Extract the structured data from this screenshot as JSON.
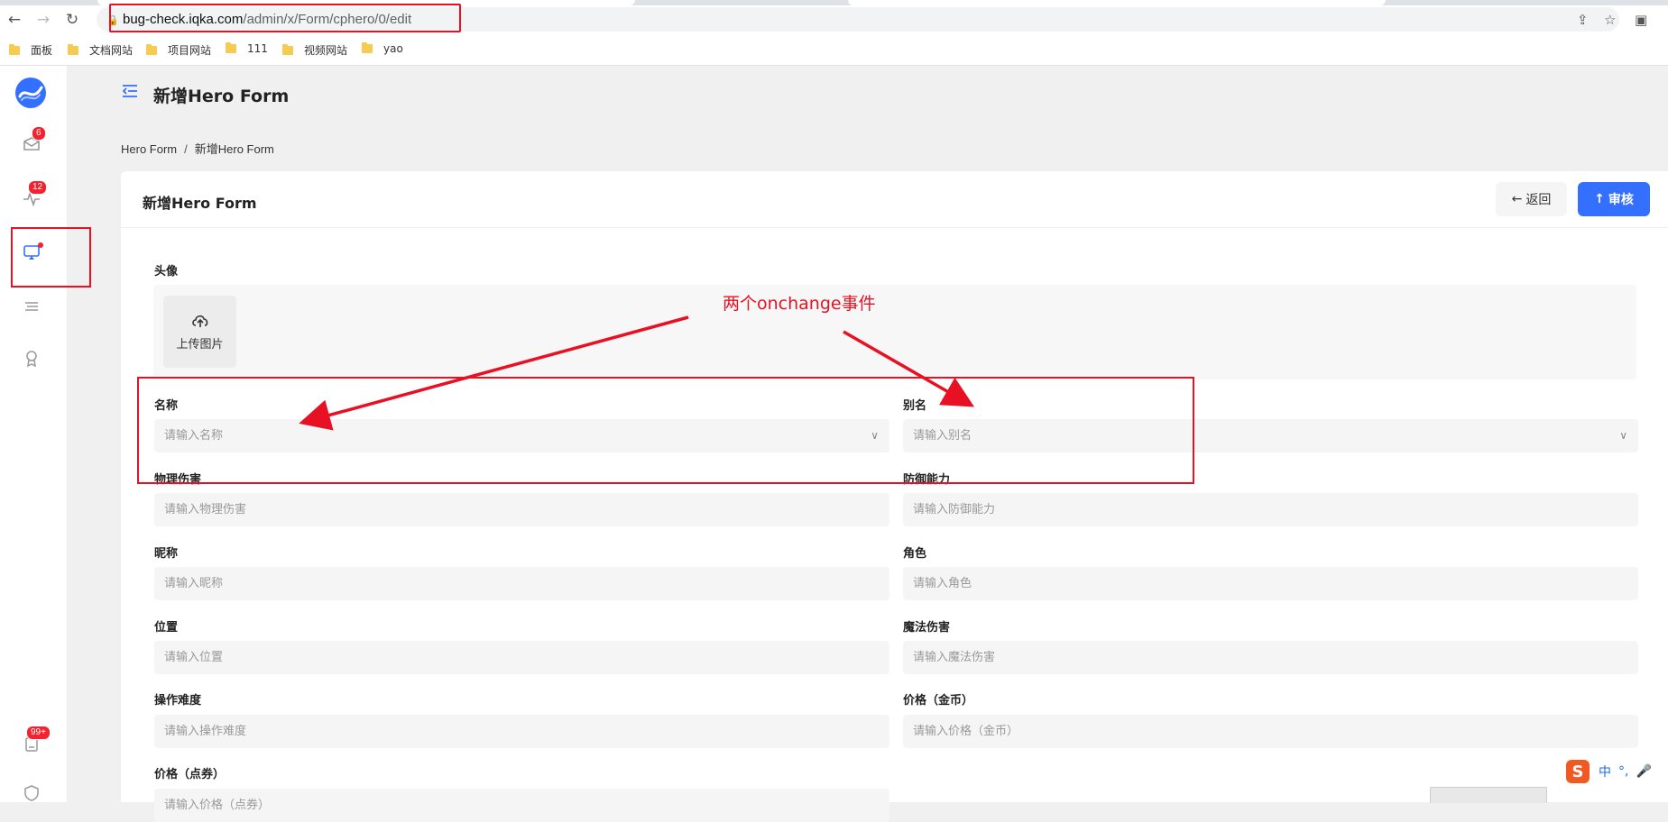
{
  "browser": {
    "url_host": "bug-check.iqka.com",
    "url_path": "/admin/x/Form/cphero/0/edit",
    "bookmarks": [
      "面板",
      "文档网站",
      "项目网站",
      "111",
      "视频网站",
      "yao"
    ]
  },
  "sidebar": {
    "badges": [
      "6",
      "12",
      "99+"
    ]
  },
  "header": {
    "title": "新增Hero Form"
  },
  "breadcrumb": {
    "parent": "Hero Form",
    "separator": "/",
    "current": "新增Hero Form"
  },
  "card": {
    "title": "新增Hero Form",
    "back_label": "返回",
    "approve_label": "审核"
  },
  "form": {
    "avatar_label": "头像",
    "upload_label": "上传图片",
    "fields": [
      {
        "label": "名称",
        "placeholder": "请输入名称"
      },
      {
        "label": "别名",
        "placeholder": "请输入别名"
      },
      {
        "label": "物理伤害",
        "placeholder": "请输入物理伤害"
      },
      {
        "label": "防御能力",
        "placeholder": "请输入防御能力"
      },
      {
        "label": "昵称",
        "placeholder": "请输入昵称"
      },
      {
        "label": "角色",
        "placeholder": "请输入角色"
      },
      {
        "label": "位置",
        "placeholder": "请输入位置"
      },
      {
        "label": "魔法伤害",
        "placeholder": "请输入魔法伤害"
      },
      {
        "label": "操作难度",
        "placeholder": "请输入操作难度"
      },
      {
        "label": "价格（金币）",
        "placeholder": "请输入价格（金币）"
      },
      {
        "label": "价格（点券）",
        "placeholder": "请输入价格（点券）"
      }
    ]
  },
  "annotation": {
    "text": "两个onchange事件",
    "color": "#e81123"
  },
  "ime": {
    "logo": "S",
    "lang": "中",
    "punct": "°,"
  },
  "colors": {
    "primary": "#3370ff",
    "badge": "#f5222d"
  }
}
